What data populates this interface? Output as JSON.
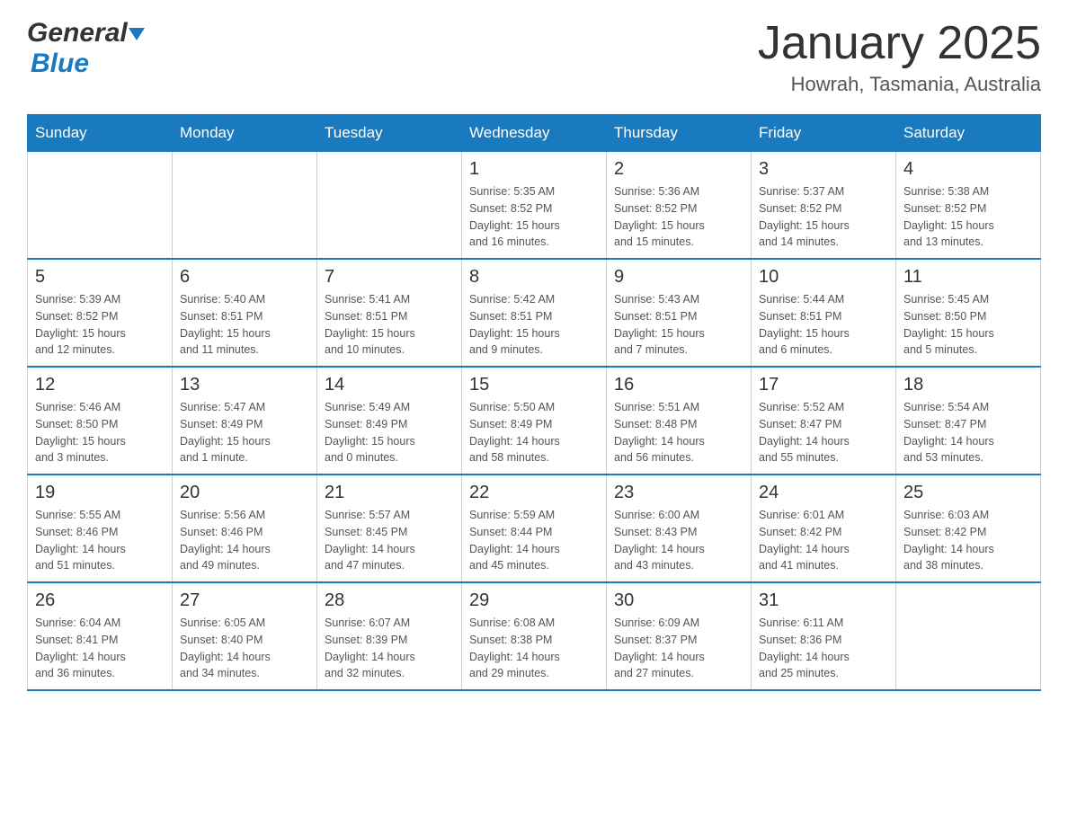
{
  "header": {
    "logo_general": "General",
    "logo_blue": "Blue",
    "title": "January 2025",
    "subtitle": "Howrah, Tasmania, Australia"
  },
  "calendar": {
    "days_of_week": [
      "Sunday",
      "Monday",
      "Tuesday",
      "Wednesday",
      "Thursday",
      "Friday",
      "Saturday"
    ],
    "weeks": [
      [
        {
          "day": "",
          "info": ""
        },
        {
          "day": "",
          "info": ""
        },
        {
          "day": "",
          "info": ""
        },
        {
          "day": "1",
          "info": "Sunrise: 5:35 AM\nSunset: 8:52 PM\nDaylight: 15 hours\nand 16 minutes."
        },
        {
          "day": "2",
          "info": "Sunrise: 5:36 AM\nSunset: 8:52 PM\nDaylight: 15 hours\nand 15 minutes."
        },
        {
          "day": "3",
          "info": "Sunrise: 5:37 AM\nSunset: 8:52 PM\nDaylight: 15 hours\nand 14 minutes."
        },
        {
          "day": "4",
          "info": "Sunrise: 5:38 AM\nSunset: 8:52 PM\nDaylight: 15 hours\nand 13 minutes."
        }
      ],
      [
        {
          "day": "5",
          "info": "Sunrise: 5:39 AM\nSunset: 8:52 PM\nDaylight: 15 hours\nand 12 minutes."
        },
        {
          "day": "6",
          "info": "Sunrise: 5:40 AM\nSunset: 8:51 PM\nDaylight: 15 hours\nand 11 minutes."
        },
        {
          "day": "7",
          "info": "Sunrise: 5:41 AM\nSunset: 8:51 PM\nDaylight: 15 hours\nand 10 minutes."
        },
        {
          "day": "8",
          "info": "Sunrise: 5:42 AM\nSunset: 8:51 PM\nDaylight: 15 hours\nand 9 minutes."
        },
        {
          "day": "9",
          "info": "Sunrise: 5:43 AM\nSunset: 8:51 PM\nDaylight: 15 hours\nand 7 minutes."
        },
        {
          "day": "10",
          "info": "Sunrise: 5:44 AM\nSunset: 8:51 PM\nDaylight: 15 hours\nand 6 minutes."
        },
        {
          "day": "11",
          "info": "Sunrise: 5:45 AM\nSunset: 8:50 PM\nDaylight: 15 hours\nand 5 minutes."
        }
      ],
      [
        {
          "day": "12",
          "info": "Sunrise: 5:46 AM\nSunset: 8:50 PM\nDaylight: 15 hours\nand 3 minutes."
        },
        {
          "day": "13",
          "info": "Sunrise: 5:47 AM\nSunset: 8:49 PM\nDaylight: 15 hours\nand 1 minute."
        },
        {
          "day": "14",
          "info": "Sunrise: 5:49 AM\nSunset: 8:49 PM\nDaylight: 15 hours\nand 0 minutes."
        },
        {
          "day": "15",
          "info": "Sunrise: 5:50 AM\nSunset: 8:49 PM\nDaylight: 14 hours\nand 58 minutes."
        },
        {
          "day": "16",
          "info": "Sunrise: 5:51 AM\nSunset: 8:48 PM\nDaylight: 14 hours\nand 56 minutes."
        },
        {
          "day": "17",
          "info": "Sunrise: 5:52 AM\nSunset: 8:47 PM\nDaylight: 14 hours\nand 55 minutes."
        },
        {
          "day": "18",
          "info": "Sunrise: 5:54 AM\nSunset: 8:47 PM\nDaylight: 14 hours\nand 53 minutes."
        }
      ],
      [
        {
          "day": "19",
          "info": "Sunrise: 5:55 AM\nSunset: 8:46 PM\nDaylight: 14 hours\nand 51 minutes."
        },
        {
          "day": "20",
          "info": "Sunrise: 5:56 AM\nSunset: 8:46 PM\nDaylight: 14 hours\nand 49 minutes."
        },
        {
          "day": "21",
          "info": "Sunrise: 5:57 AM\nSunset: 8:45 PM\nDaylight: 14 hours\nand 47 minutes."
        },
        {
          "day": "22",
          "info": "Sunrise: 5:59 AM\nSunset: 8:44 PM\nDaylight: 14 hours\nand 45 minutes."
        },
        {
          "day": "23",
          "info": "Sunrise: 6:00 AM\nSunset: 8:43 PM\nDaylight: 14 hours\nand 43 minutes."
        },
        {
          "day": "24",
          "info": "Sunrise: 6:01 AM\nSunset: 8:42 PM\nDaylight: 14 hours\nand 41 minutes."
        },
        {
          "day": "25",
          "info": "Sunrise: 6:03 AM\nSunset: 8:42 PM\nDaylight: 14 hours\nand 38 minutes."
        }
      ],
      [
        {
          "day": "26",
          "info": "Sunrise: 6:04 AM\nSunset: 8:41 PM\nDaylight: 14 hours\nand 36 minutes."
        },
        {
          "day": "27",
          "info": "Sunrise: 6:05 AM\nSunset: 8:40 PM\nDaylight: 14 hours\nand 34 minutes."
        },
        {
          "day": "28",
          "info": "Sunrise: 6:07 AM\nSunset: 8:39 PM\nDaylight: 14 hours\nand 32 minutes."
        },
        {
          "day": "29",
          "info": "Sunrise: 6:08 AM\nSunset: 8:38 PM\nDaylight: 14 hours\nand 29 minutes."
        },
        {
          "day": "30",
          "info": "Sunrise: 6:09 AM\nSunset: 8:37 PM\nDaylight: 14 hours\nand 27 minutes."
        },
        {
          "day": "31",
          "info": "Sunrise: 6:11 AM\nSunset: 8:36 PM\nDaylight: 14 hours\nand 25 minutes."
        },
        {
          "day": "",
          "info": ""
        }
      ]
    ]
  }
}
